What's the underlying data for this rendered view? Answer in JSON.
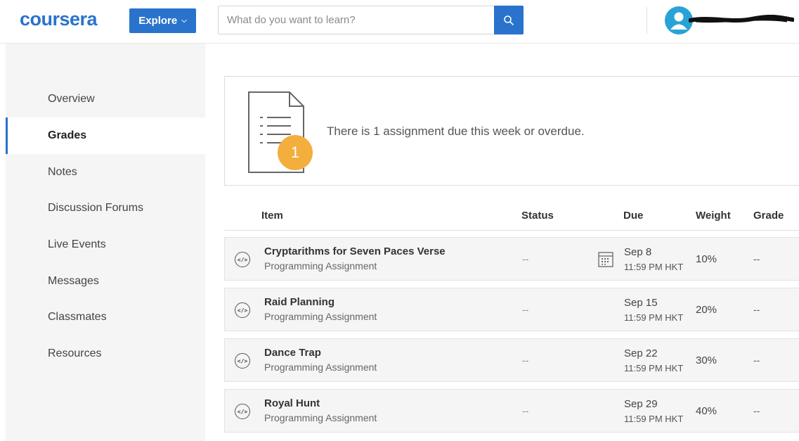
{
  "header": {
    "logo": "coursera",
    "explore_label": "Explore",
    "search_placeholder": "What do you want to learn?"
  },
  "sidebar": {
    "items": [
      {
        "label": "Overview"
      },
      {
        "label": "Grades"
      },
      {
        "label": "Notes"
      },
      {
        "label": "Discussion Forums"
      },
      {
        "label": "Live Events"
      },
      {
        "label": "Messages"
      },
      {
        "label": "Classmates"
      },
      {
        "label": "Resources"
      }
    ],
    "active": "Grades"
  },
  "summary": {
    "count": "1",
    "text": "There is 1 assignment due this week or overdue."
  },
  "table": {
    "columns": {
      "item": "Item",
      "status": "Status",
      "due": "Due",
      "weight": "Weight",
      "grade": "Grade"
    },
    "rows": [
      {
        "title": "Cryptarithms for Seven Paces Verse",
        "type": "Programming Assignment",
        "status": "--",
        "due_date": "Sep 8",
        "due_time": "11:59 PM HKT",
        "weight": "10%",
        "grade": "--"
      },
      {
        "title": "Raid Planning",
        "type": "Programming Assignment",
        "status": "--",
        "due_date": "Sep 15",
        "due_time": "11:59 PM HKT",
        "weight": "20%",
        "grade": "--"
      },
      {
        "title": "Dance Trap",
        "type": "Programming Assignment",
        "status": "--",
        "due_date": "Sep 22",
        "due_time": "11:59 PM HKT",
        "weight": "30%",
        "grade": "--"
      },
      {
        "title": "Royal Hunt",
        "type": "Programming Assignment",
        "status": "--",
        "due_date": "Sep 29",
        "due_time": "11:59 PM HKT",
        "weight": "40%",
        "grade": "--"
      }
    ]
  },
  "icons": {
    "search": "search-icon",
    "avatar": "user-avatar-icon",
    "assignment": "code-icon",
    "calendar": "calendar-icon",
    "document": "document-icon"
  },
  "colors": {
    "brand": "#2a73cc",
    "badge": "#f3ae3d",
    "avatar": "#29a3d6"
  }
}
